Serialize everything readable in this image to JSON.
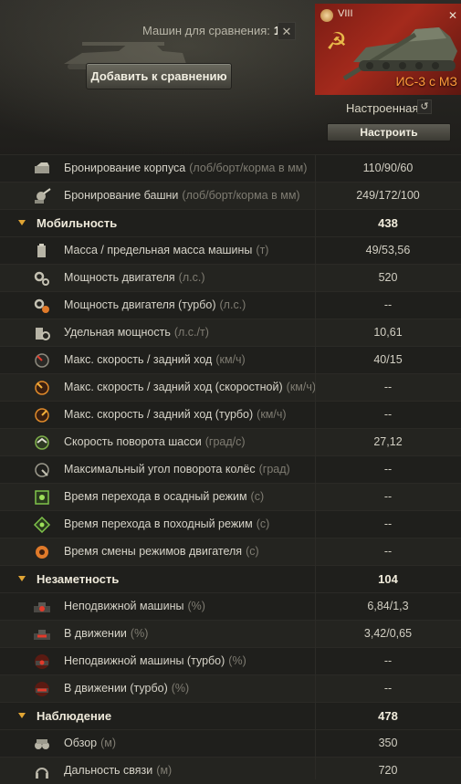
{
  "header": {
    "compare_label": "Машин для сравнения:",
    "compare_count": "1",
    "close_label": "✕",
    "add_button": "Добавить к сравнению"
  },
  "tank": {
    "tier": "VIII",
    "name": "ИС-3 с МЗ",
    "config_label": "Настроенная",
    "configure_button": "Настроить",
    "accent_color": "#ff9c3a"
  },
  "rows": [
    {
      "type": "stat",
      "icon": "hull-armor-icon",
      "label": "Бронирование корпуса",
      "unit": "(лоб/борт/корма в мм)",
      "value": "110/90/60"
    },
    {
      "type": "stat",
      "icon": "turret-armor-icon",
      "label": "Бронирование башни",
      "unit": "(лоб/борт/корма в мм)",
      "value": "249/172/100"
    },
    {
      "type": "section",
      "label": "Мобильность",
      "value": "438"
    },
    {
      "type": "stat",
      "icon": "weight-icon",
      "label": "Масса / предельная масса машины",
      "unit": "(т)",
      "value": "49/53,56"
    },
    {
      "type": "stat",
      "icon": "engine-power-icon",
      "label": "Мощность двигателя",
      "unit": "(л.с.)",
      "value": "520"
    },
    {
      "type": "stat",
      "icon": "engine-turbo-icon",
      "label": "Мощность двигателя (турбо)",
      "unit": "(л.с.)",
      "value": "--"
    },
    {
      "type": "stat",
      "icon": "specific-power-icon",
      "label": "Удельная мощность",
      "unit": "(л.с./т)",
      "value": "10,61"
    },
    {
      "type": "stat",
      "icon": "speed-icon",
      "label": "Макс. скорость / задний ход",
      "unit": "(км/ч)",
      "value": "40/15"
    },
    {
      "type": "stat",
      "icon": "speed-fast-icon",
      "label": "Макс. скорость / задний ход (скоростной)",
      "unit": "(км/ч)",
      "value": "--"
    },
    {
      "type": "stat",
      "icon": "speed-turbo-icon",
      "label": "Макс. скорость / задний ход (турбо)",
      "unit": "(км/ч)",
      "value": "--"
    },
    {
      "type": "stat",
      "icon": "traverse-icon",
      "label": "Скорость поворота шасси",
      "unit": "(град/с)",
      "value": "27,12"
    },
    {
      "type": "stat",
      "icon": "wheel-angle-icon",
      "label": "Максимальный угол поворота колёс",
      "unit": "(град)",
      "value": "--"
    },
    {
      "type": "stat",
      "icon": "siege-mode-icon",
      "label": "Время перехода в осадный режим",
      "unit": "(с)",
      "value": "--"
    },
    {
      "type": "stat",
      "icon": "travel-mode-icon",
      "label": "Время перехода в походный режим",
      "unit": "(с)",
      "value": "--"
    },
    {
      "type": "stat",
      "icon": "engine-mode-icon",
      "label": "Время смены режимов двигателя",
      "unit": "(с)",
      "value": "--"
    },
    {
      "type": "section",
      "label": "Незаметность",
      "value": "104"
    },
    {
      "type": "stat",
      "icon": "camo-stationary-icon",
      "label": "Неподвижной машины",
      "unit": "(%)",
      "value": "6,84/1,3"
    },
    {
      "type": "stat",
      "icon": "camo-moving-icon",
      "label": "В движении",
      "unit": "(%)",
      "value": "3,42/0,65"
    },
    {
      "type": "stat",
      "icon": "camo-stationary-turbo-icon",
      "label": "Неподвижной машины (турбо)",
      "unit": "(%)",
      "value": "--"
    },
    {
      "type": "stat",
      "icon": "camo-moving-turbo-icon",
      "label": "В движении (турбо)",
      "unit": "(%)",
      "value": "--"
    },
    {
      "type": "section",
      "label": "Наблюдение",
      "value": "478"
    },
    {
      "type": "stat",
      "icon": "view-range-icon",
      "label": "Обзор",
      "unit": "(м)",
      "value": "350"
    },
    {
      "type": "stat",
      "icon": "radio-range-icon",
      "label": "Дальность связи",
      "unit": "(м)",
      "value": "720"
    }
  ]
}
